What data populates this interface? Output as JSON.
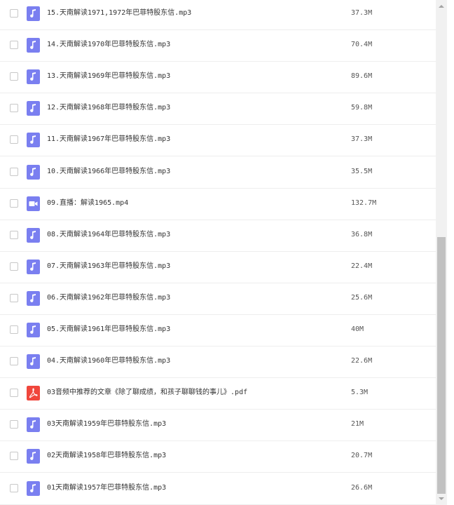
{
  "colors": {
    "audio_icon": "#7a7ff0",
    "video_icon": "#7a7ff0",
    "pdf_icon": "#f0463c",
    "row_border": "#eeeeee",
    "scroll_thumb": "#c1c1c1"
  },
  "files": [
    {
      "name": "15.天南解读1971,1972年巴菲特股东信.mp3",
      "size": "37.3M",
      "icon": "music-note-icon",
      "type": "audio"
    },
    {
      "name": "14.天南解读1970年巴菲特股东信.mp3",
      "size": "70.4M",
      "icon": "music-note-icon",
      "type": "audio"
    },
    {
      "name": "13.天南解读1969年巴菲特股东信.mp3",
      "size": "89.6M",
      "icon": "music-note-icon",
      "type": "audio"
    },
    {
      "name": "12.天南解读1968年巴菲特股东信.mp3",
      "size": "59.8M",
      "icon": "music-note-icon",
      "type": "audio"
    },
    {
      "name": "11.天南解读1967年巴菲特股东信.mp3",
      "size": "37.3M",
      "icon": "music-note-icon",
      "type": "audio"
    },
    {
      "name": "10.天南解读1966年巴菲特股东信.mp3",
      "size": "35.5M",
      "icon": "music-note-icon",
      "type": "audio"
    },
    {
      "name": "09.直播：解读1965.mp4",
      "size": "132.7M",
      "icon": "video-camera-icon",
      "type": "video"
    },
    {
      "name": "08.天南解读1964年巴菲特股东信.mp3",
      "size": "36.8M",
      "icon": "music-note-icon",
      "type": "audio"
    },
    {
      "name": "07.天南解读1963年巴菲特股东信.mp3",
      "size": "22.4M",
      "icon": "music-note-icon",
      "type": "audio"
    },
    {
      "name": "06.天南解读1962年巴菲特股东信.mp3",
      "size": "25.6M",
      "icon": "music-note-icon",
      "type": "audio"
    },
    {
      "name": "05.天南解读1961年巴菲特股东信.mp3",
      "size": "40M",
      "icon": "music-note-icon",
      "type": "audio"
    },
    {
      "name": "04.天南解读1960年巴菲特股东信.mp3",
      "size": "22.6M",
      "icon": "music-note-icon",
      "type": "audio"
    },
    {
      "name": "03音频中推荐的文章《除了聊成绩，和孩子聊聊钱的事儿》.pdf",
      "size": "5.3M",
      "icon": "pdf-icon",
      "type": "pdf"
    },
    {
      "name": "03天南解读1959年巴菲特股东信.mp3",
      "size": "21M",
      "icon": "music-note-icon",
      "type": "audio"
    },
    {
      "name": "02天南解读1958年巴菲特股东信.mp3",
      "size": "20.7M",
      "icon": "music-note-icon",
      "type": "audio"
    },
    {
      "name": "01天南解读1957年巴菲特股东信.mp3",
      "size": "26.6M",
      "icon": "music-note-icon",
      "type": "audio"
    }
  ]
}
